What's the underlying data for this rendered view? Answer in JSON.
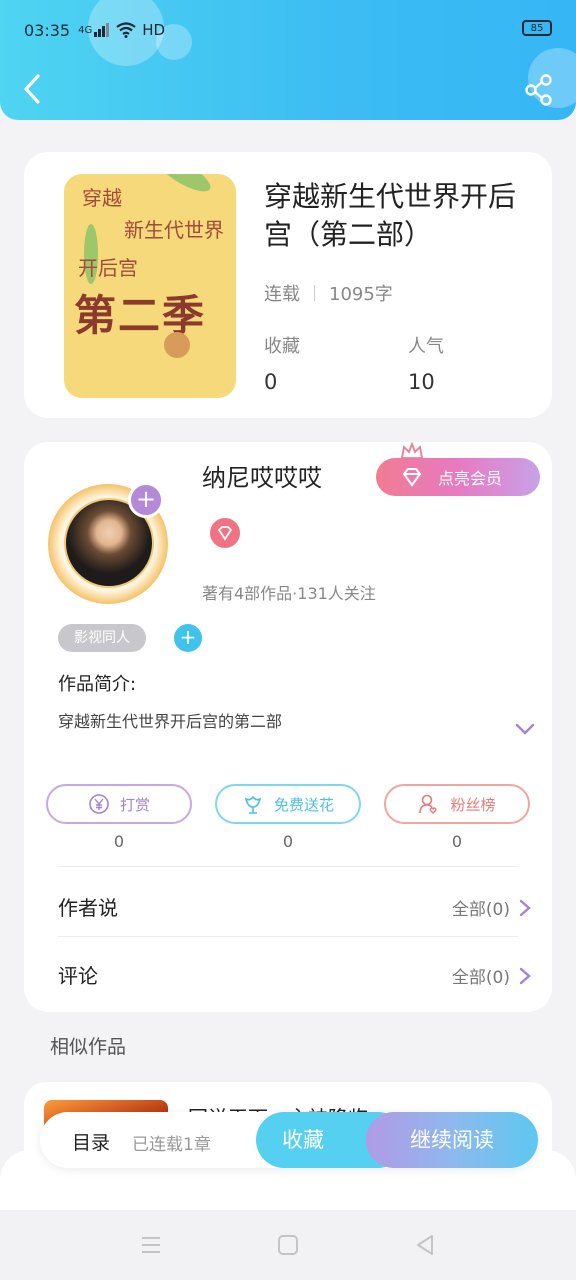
{
  "status_bar": {
    "time": "03:35",
    "signal": "4G",
    "network": "HD",
    "battery": "85"
  },
  "header": {
    "back_icon": "chevron-left-icon",
    "share_icon": "share-icon"
  },
  "book": {
    "title": "穿越新生代世界开后宫（第二部）",
    "cover_lines": [
      "穿越",
      "新生代世界",
      "开后宫",
      "第二季"
    ],
    "serial_status": "连载",
    "word_count": "1095字",
    "favorites_label": "收藏",
    "favorites_value": "0",
    "popularity_label": "人气",
    "popularity_value": "10"
  },
  "author": {
    "name": "纳尼哎哎哎",
    "vip_label": "点亮会员",
    "meta": "著有4部作品·131人关注",
    "tag": "影视同人",
    "intro_label": "作品简介:",
    "intro_text": "穿越新生代世界开后宫的第二部"
  },
  "actions": [
    {
      "label": "打赏",
      "count": "0",
      "icon": "yen-coin-icon"
    },
    {
      "label": "免费送花",
      "count": "0",
      "icon": "flower-icon"
    },
    {
      "label": "粉丝榜",
      "count": "0",
      "icon": "fan-user-icon"
    }
  ],
  "author_says": {
    "label": "作者说",
    "link": "全部(0)"
  },
  "comments": {
    "label": "评论",
    "link": "全部(0)"
  },
  "similar": {
    "title": "相似作品",
    "first_item_title": "回说天下：主神降临"
  },
  "bottom_bar": {
    "toc": "目录",
    "chapters": "已连载1章",
    "collect": "收藏",
    "read": "继续阅读"
  },
  "colors": {
    "header": "#3cbcf3",
    "accent_purple": "#b28ad8",
    "accent_cyan": "#56d0f0",
    "vip_pink": "#f07c92"
  }
}
